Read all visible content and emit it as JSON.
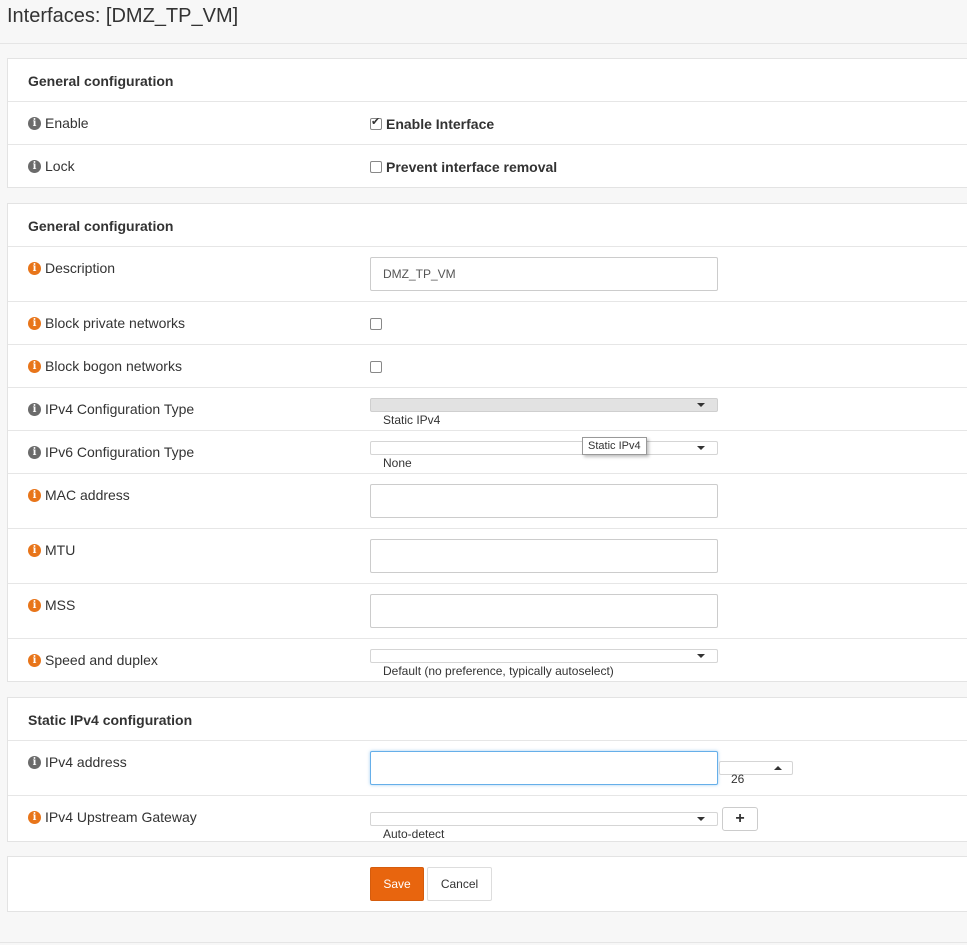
{
  "page": {
    "title": "Interfaces: [DMZ_TP_VM]"
  },
  "section1": {
    "title": "General configuration",
    "enable": {
      "label": "Enable",
      "checkbox_label": "Enable Interface",
      "checked": true
    },
    "lock": {
      "label": "Lock",
      "checkbox_label": "Prevent interface removal",
      "checked": false
    }
  },
  "section2": {
    "title": "General configuration",
    "description": {
      "label": "Description",
      "value": "DMZ_TP_VM"
    },
    "block_private": {
      "label": "Block private networks",
      "checked": false
    },
    "block_bogon": {
      "label": "Block bogon networks",
      "checked": false
    },
    "ipv4_type": {
      "label": "IPv4 Configuration Type",
      "value": "Static IPv4"
    },
    "ipv6_type": {
      "label": "IPv6 Configuration Type",
      "value": "None",
      "tooltip": "Static IPv4"
    },
    "mac": {
      "label": "MAC address",
      "value": ""
    },
    "mtu": {
      "label": "MTU",
      "value": ""
    },
    "mss": {
      "label": "MSS",
      "value": ""
    },
    "speed": {
      "label": "Speed and duplex",
      "value": "Default (no preference, typically autoselect)"
    }
  },
  "section3": {
    "title": "Static IPv4 configuration",
    "ipv4_address": {
      "label": "IPv4 address",
      "value": "",
      "subnet": "26"
    },
    "gateway": {
      "label": "IPv4 Upstream Gateway",
      "value": "Auto-detect",
      "add_label": "+"
    }
  },
  "actions": {
    "save": "Save",
    "cancel": "Cancel"
  },
  "colors": {
    "accent": "#e8650e",
    "info_orange": "#e8751a",
    "info_grey": "#6b6b6b",
    "focus": "#66afe9"
  },
  "icons": {
    "info": "info-circle-icon",
    "check": "checkmark-icon",
    "caret": "caret-down-icon",
    "plus": "plus-icon"
  }
}
